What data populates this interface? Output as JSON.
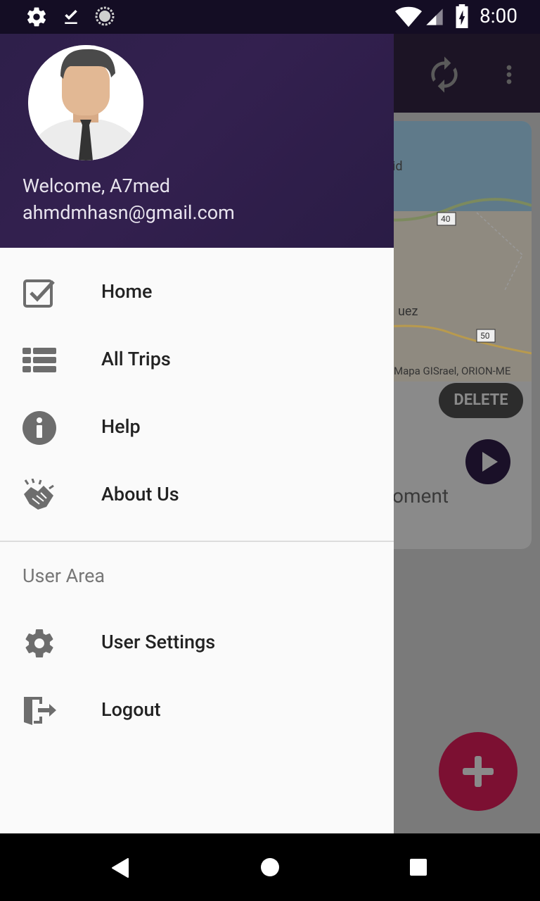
{
  "status_bar": {
    "time": "8:00",
    "left_icons": [
      "settings-icon",
      "download-done-icon",
      "sync-progress-icon"
    ],
    "right_icons": [
      "wifi-icon",
      "cell-signal-icon",
      "battery-charging-icon"
    ]
  },
  "background_app": {
    "toolbar_icons": [
      "refresh-icon",
      "more-vert-icon"
    ],
    "card": {
      "map_labels": [
        "id",
        "uez",
        "40",
        "50"
      ],
      "map_credit": "Mapa GISrael, ORION-ME",
      "delete_label": "DELETE",
      "title_tail": "oment"
    },
    "fab_icon": "add-icon"
  },
  "drawer": {
    "header": {
      "welcome": "Welcome, A7med",
      "email": "ahmdmhasn@gmail.com"
    },
    "menu": [
      {
        "label": "Home",
        "icon": "check-box-icon"
      },
      {
        "label": "All Trips",
        "icon": "list-icon"
      },
      {
        "label": "Help",
        "icon": "info-icon"
      },
      {
        "label": "About Us",
        "icon": "handshake-icon"
      }
    ],
    "section_title": "User Area",
    "user_menu": [
      {
        "label": "User Settings",
        "icon": "settings-icon"
      },
      {
        "label": "Logout",
        "icon": "logout-icon"
      }
    ]
  },
  "nav_bar": {
    "buttons": [
      "back-button",
      "home-button",
      "recents-button"
    ]
  },
  "colors": {
    "drawer_header": "#2e1f4a",
    "fab": "#c2185b",
    "status_bar": "#140d24"
  }
}
